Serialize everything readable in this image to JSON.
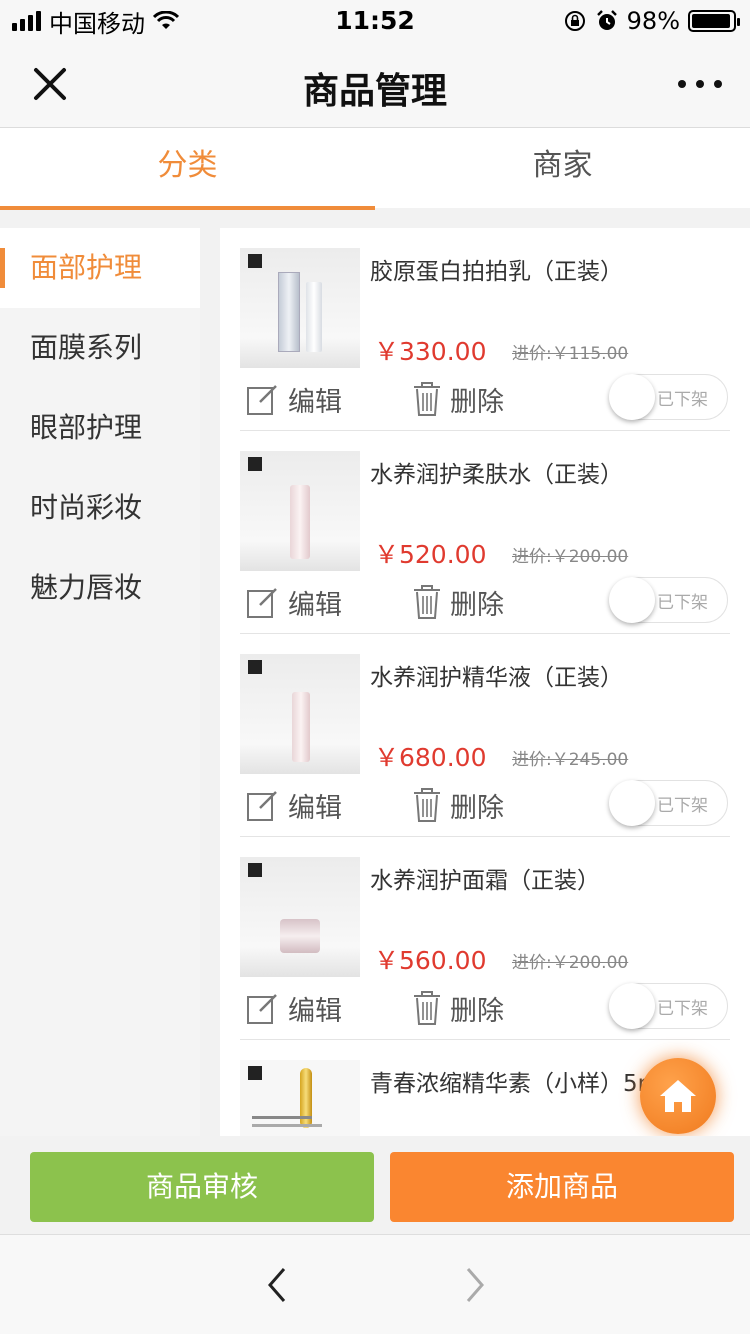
{
  "status_bar": {
    "carrier": "中国移动",
    "time": "11:52",
    "battery": "98%"
  },
  "nav": {
    "title": "商品管理",
    "close_icon": "close-icon",
    "more_icon": "more-icon"
  },
  "tabs": [
    {
      "label": "分类",
      "active": true
    },
    {
      "label": "商家",
      "active": false
    }
  ],
  "categories": [
    {
      "label": "面部护理",
      "active": true
    },
    {
      "label": "面膜系列",
      "active": false
    },
    {
      "label": "眼部护理",
      "active": false
    },
    {
      "label": "时尚彩妆",
      "active": false
    },
    {
      "label": "魅力唇妆",
      "active": false
    }
  ],
  "product_actions": {
    "edit": "编辑",
    "delete": "删除",
    "toggle": "已下架"
  },
  "products": [
    {
      "name": "胶原蛋白拍拍乳（正装）",
      "price": "￥330.00",
      "cost": "进价:￥115.00"
    },
    {
      "name": "水养润护柔肤水（正装）",
      "price": "￥520.00",
      "cost": "进价:￥200.00"
    },
    {
      "name": "水养润护精华液（正装）",
      "price": "￥680.00",
      "cost": "进价:￥245.00"
    },
    {
      "name": "水养润护面霜（正装）",
      "price": "￥560.00",
      "cost": "进价:￥200.00"
    },
    {
      "name": "青春浓缩精华素（小样）5ml",
      "price": "",
      "cost": ""
    }
  ],
  "buttons": {
    "review": "商品审核",
    "add": "添加商品"
  },
  "colors": {
    "accent": "#f08c3a",
    "price": "#e03a2f",
    "review_button": "#8cc24d",
    "add_button": "#fa8630"
  }
}
